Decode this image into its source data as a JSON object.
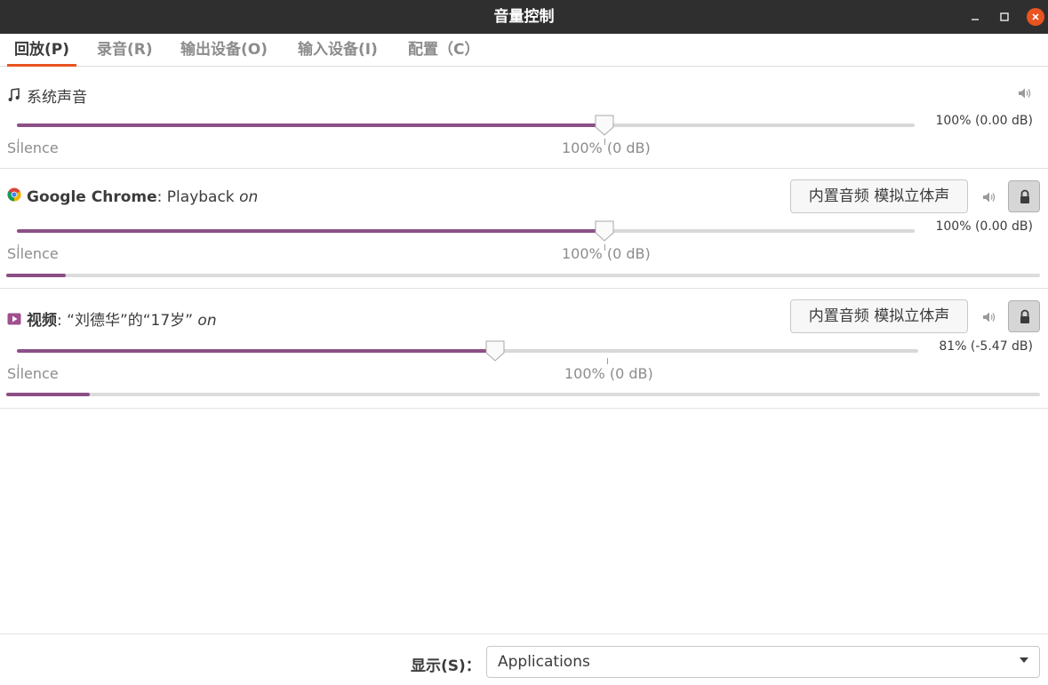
{
  "window": {
    "title": "音量控制"
  },
  "tabs": [
    {
      "label": "回放(P)",
      "active": true
    },
    {
      "label": "录音(R)"
    },
    {
      "label": "输出设备(O)"
    },
    {
      "label": "输入设备(I)"
    },
    {
      "label": "配置（C）"
    }
  ],
  "streams": [
    {
      "name": "系统声音",
      "icon": "music-note-icon",
      "slider_label_silence": "Silence",
      "slider_label_100": "100% (0 dB)",
      "volume_text": "100% (0.00 dB)",
      "volume_fraction": 1.0
    },
    {
      "app": "Google Chrome",
      "separator": ":",
      "stream": "Playback",
      "status": "on",
      "icon": "chrome-icon",
      "device": "内置音频 模拟立体声",
      "slider_label_silence": "Silence",
      "slider_label_100": "100% (0 dB)",
      "volume_text": "100% (0.00 dB)",
      "volume_fraction": 1.0,
      "peak_fraction": 0.058
    },
    {
      "app": "视频",
      "separator": ":",
      "stream": "“刘德华”的“17岁”",
      "status": "on",
      "icon": "video-player-icon",
      "device": "内置音频 模拟立体声",
      "slider_label_silence": "Silence",
      "slider_label_100": "100% (0 dB)",
      "volume_text": "81% (-5.47 dB)",
      "volume_fraction": 0.81,
      "peak_fraction": 0.081
    }
  ],
  "footer": {
    "show_label": "显示(S)：",
    "show_value": "Applications"
  },
  "colors": {
    "accent": "#e95420",
    "slider_fill": "#8b4f85",
    "titlebar": "#2f2f2f"
  }
}
